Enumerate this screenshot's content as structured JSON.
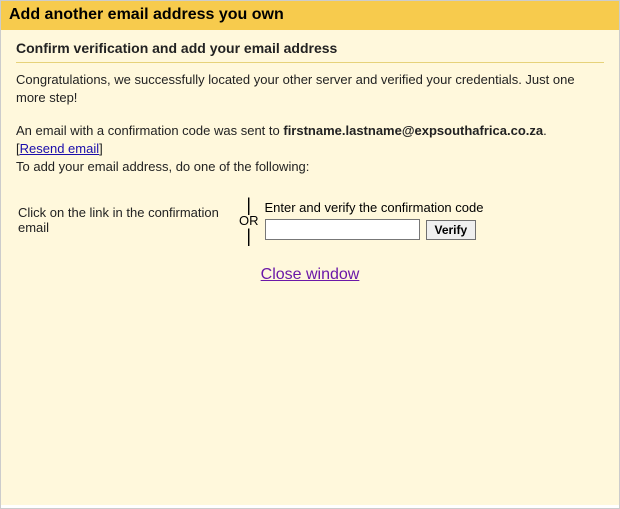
{
  "titlebar": {
    "title": "Add another email address you own"
  },
  "section": {
    "heading": "Confirm verification and add your email address"
  },
  "msg": {
    "congrats": "Congratulations, we successfully located your other server and verified your credentials. Just one more step!",
    "sent_prefix": "An email with a confirmation code was sent to ",
    "email": "firstname.lastname@expsouthafrica.co.za",
    "sent_suffix": ".",
    "resend": "Resend email",
    "to_add": "To add your email address, do one of the following:"
  },
  "option": {
    "left": "Click on the link in the confirmation email",
    "or": "OR",
    "right_label": "Enter and verify the confirmation code",
    "verify": "Verify"
  },
  "close": {
    "label": "Close window"
  }
}
